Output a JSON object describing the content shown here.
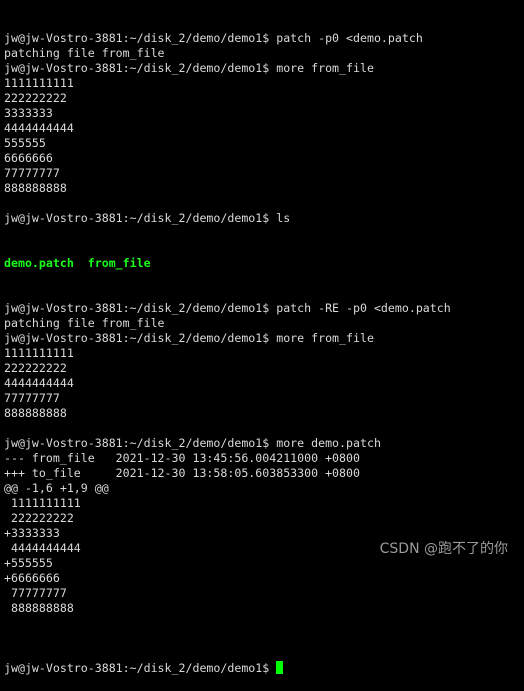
{
  "terminal": {
    "prompt": "jw@jw-Vostro-3881:~/disk_2/demo/demo1$ ",
    "lines": [
      "jw@jw-Vostro-3881:~/disk_2/demo/demo1$ patch -p0 <demo.patch",
      "patching file from_file",
      "jw@jw-Vostro-3881:~/disk_2/demo/demo1$ more from_file",
      "1111111111",
      "222222222",
      "3333333",
      "4444444444",
      "555555",
      "6666666",
      "77777777",
      "888888888",
      "",
      "jw@jw-Vostro-3881:~/disk_2/demo/demo1$ ls"
    ],
    "ls_output": "demo.patch  from_file",
    "lines2": [
      "jw@jw-Vostro-3881:~/disk_2/demo/demo1$ patch -RE -p0 <demo.patch",
      "patching file from_file",
      "jw@jw-Vostro-3881:~/disk_2/demo/demo1$ more from_file",
      "1111111111",
      "222222222",
      "4444444444",
      "77777777",
      "888888888",
      "",
      "jw@jw-Vostro-3881:~/disk_2/demo/demo1$ more demo.patch",
      "--- from_file   2021-12-30 13:45:56.004211000 +0800",
      "+++ to_file     2021-12-30 13:58:05.603853300 +0800",
      "@@ -1,6 +1,9 @@",
      " 1111111111",
      " 222222222",
      "+3333333",
      " 4444444444",
      "+555555",
      "+6666666",
      " 77777777",
      " 888888888",
      ""
    ],
    "cursor_color": "#00ff00",
    "ls_color": "#1aff1a"
  },
  "watermark": "CSDN @跑不了的你"
}
